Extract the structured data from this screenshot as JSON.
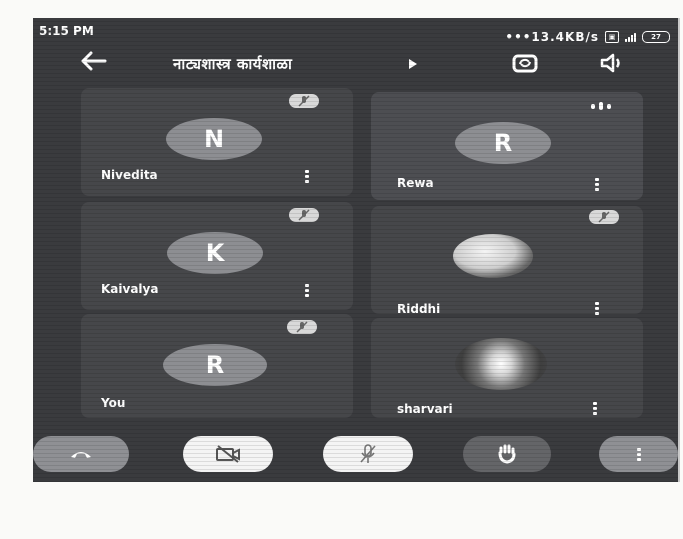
{
  "status_bar": {
    "time": "5:15 PM",
    "network_speed": "13.4KB/s",
    "battery": "27"
  },
  "header": {
    "title": "नाट्यशास्त्र कार्यशाळा"
  },
  "participants": [
    {
      "name": "Nivedita",
      "avatar_letter": "N",
      "muted": true
    },
    {
      "name": "Rewa",
      "avatar_letter": "R",
      "muted": false,
      "speaking": true
    },
    {
      "name": "Kaivalya",
      "avatar_letter": "K",
      "muted": true
    },
    {
      "name": "Riddhi",
      "avatar_letter": "",
      "muted": true
    },
    {
      "name": "You",
      "avatar_letter": "R",
      "muted": true
    },
    {
      "name": "sharvari",
      "avatar_letter": "",
      "muted": false
    }
  ],
  "controls": [
    "end-call-icon",
    "camera-off-icon",
    "mic-off-icon",
    "raise-hand-icon",
    "more-options-icon"
  ],
  "colors": {
    "screen_bg": "#3a3b3e",
    "tile_bg": "#46474a",
    "avatar_bg": "#8d8e92",
    "control_light": "#f4f4f4"
  }
}
